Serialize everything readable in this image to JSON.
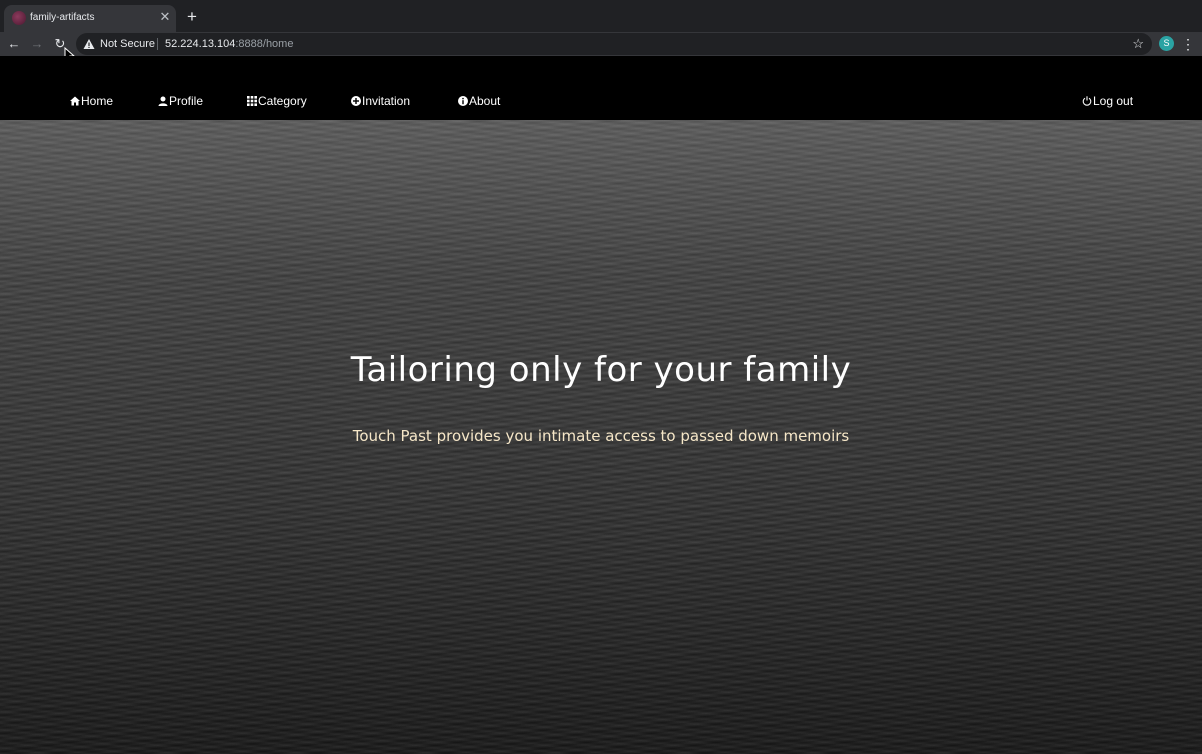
{
  "browser": {
    "tab_title": "family-artifacts",
    "security_label": "Not Secure",
    "url_host": "52.224.13.104",
    "url_rest": ":8888/home",
    "profile_initial": "S"
  },
  "navbar": {
    "items": [
      {
        "label": "Home",
        "icon": "home-icon"
      },
      {
        "label": "Profile",
        "icon": "person-icon"
      },
      {
        "label": "Category",
        "icon": "grid-icon"
      },
      {
        "label": "Invitation",
        "icon": "plus-circle-icon"
      },
      {
        "label": "About",
        "icon": "info-icon"
      }
    ],
    "logout": {
      "label": "Log out",
      "icon": "power-icon"
    }
  },
  "hero": {
    "title": "Tailoring only for your family",
    "subtitle": "Touch Past provides you intimate access to passed down memoirs"
  },
  "colors": {
    "subtitle": "#f6e7c8",
    "avatar": "#2aa3a3"
  }
}
